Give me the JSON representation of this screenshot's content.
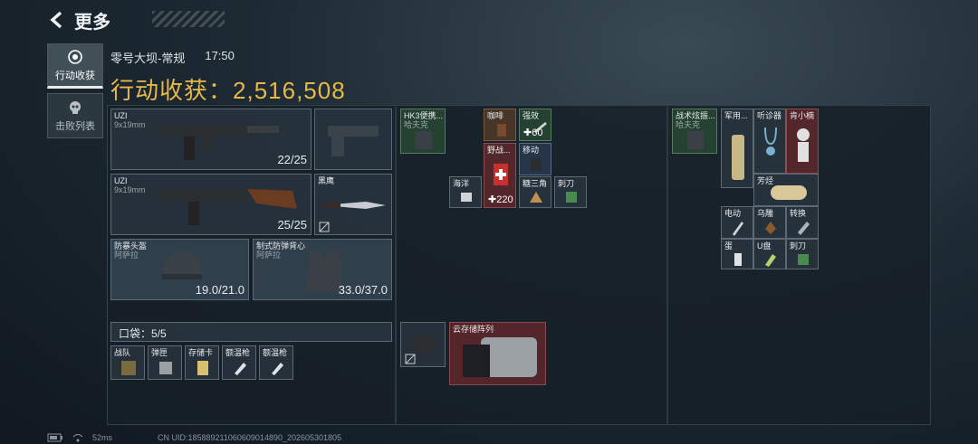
{
  "topbar": {
    "title": "更多"
  },
  "tabs": [
    {
      "label": "行动收获"
    },
    {
      "label": "击败列表"
    }
  ],
  "header": {
    "map": "零号大坝-常规",
    "time": "17:50"
  },
  "loot": {
    "label": "行动收获：",
    "value": "2,516,508"
  },
  "weapons": [
    {
      "name": "UZI",
      "caliber": "9x19mm",
      "ammo": "22/25"
    },
    {
      "name": "UZI",
      "caliber": "9x19mm",
      "ammo": "25/25"
    }
  ],
  "melee": {
    "name": "黑鹰"
  },
  "armor": [
    {
      "name": "防暴头盔",
      "sub": "阿萨拉",
      "dur": "19.0/21.0"
    },
    {
      "name": "制式防弹背心",
      "sub": "阿萨拉",
      "dur": "33.0/37.0"
    }
  ],
  "pocket": {
    "label": "口袋：",
    "count": "5/5",
    "items": [
      "战队",
      "弹匣",
      "存储卡",
      "额温枪",
      "额温枪"
    ]
  },
  "backpack": {
    "items": [
      "HK3便携...",
      "哈夫克",
      "咖啡",
      "强效",
      "60",
      "野战...",
      "移动",
      "220",
      "糖三角",
      "海洋",
      "刺刀"
    ]
  },
  "cloud": {
    "name": "云存储阵列"
  },
  "rig": {
    "items": [
      "战术炫振...",
      "哈夫克",
      "军用...",
      "听诊器",
      "肯小楠",
      "芳烃",
      "电动",
      "乌雕",
      "转换",
      "蛋",
      "U盘",
      "刺刀"
    ]
  },
  "footer": {
    "ping": "52ms",
    "uid": "CN UID:185889211060609014890_202605301805"
  }
}
